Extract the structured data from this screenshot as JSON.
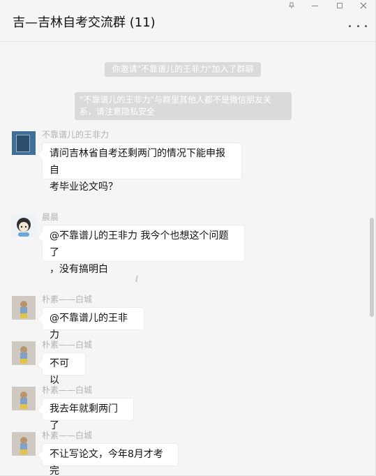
{
  "window": {
    "title": "吉—吉林自考交流群 (11)"
  },
  "notices": [
    "你邀请\"不靠谱儿的王非力\"加入了群聊",
    "\"不靠谱儿的王非力\"与群里其他人都不是微信朋友关系，请注意隐私安全"
  ],
  "messages": [
    {
      "sender": "不靠谱儿的王非力",
      "avatar": "book-cover-avatar",
      "lines": [
        "请问吉林省自考还剩两门的情况下能申报自",
        "考毕业论文吗？"
      ]
    },
    {
      "sender": "晨晨",
      "avatar": "cartoon-avatar",
      "lines": [
        "@不靠谱儿的王非力 我今个也想这个问题了",
        "，没有搞明白"
      ]
    },
    {
      "sender": "朴素——白城",
      "avatar": "child-photo-avatar",
      "lines": [
        "@不靠谱儿的王非力"
      ]
    },
    {
      "sender": "朴素——白城",
      "avatar": "child-photo-avatar",
      "lines": [
        "不可以"
      ]
    },
    {
      "sender": "朴素——白城",
      "avatar": "child-photo-avatar",
      "lines": [
        "我去年就剩两门了"
      ]
    },
    {
      "sender": "朴素——白城",
      "avatar": "child-photo-avatar",
      "lines": [
        "不让写论文，今年8月才考完"
      ]
    }
  ],
  "colors": {
    "background": "#f5f5f5",
    "bubble": "#ffffff",
    "notice": "#dadada",
    "sender_text": "#b2b2b2"
  },
  "icons": [
    "pin-icon",
    "minimize-icon",
    "maximize-icon",
    "close-icon",
    "more-icon"
  ]
}
